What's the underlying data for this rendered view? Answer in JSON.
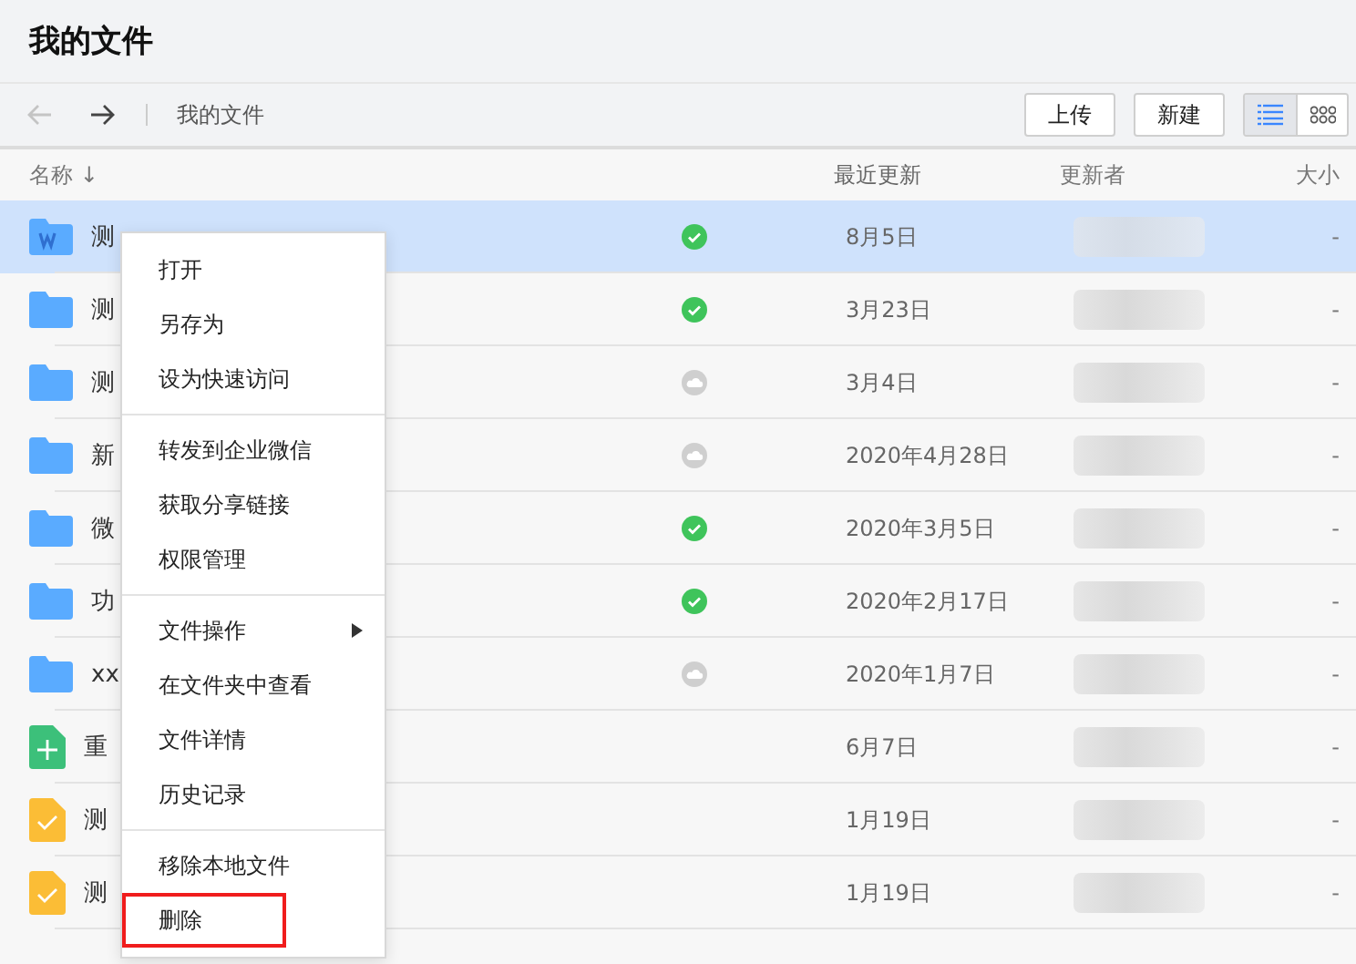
{
  "window": {
    "title": "我的文件"
  },
  "toolbar": {
    "back_disabled": true,
    "forward_disabled": false,
    "breadcrumb": "我的文件",
    "buttons": [
      "上传",
      "新建"
    ],
    "views": [
      {
        "kind": "list",
        "selected": true
      },
      {
        "kind": "grid",
        "selected": false
      }
    ]
  },
  "columns": [
    {
      "label": "名称",
      "sort": "↓"
    },
    {
      "label": "最近更新"
    },
    {
      "label": "更新者"
    },
    {
      "label": "大小"
    }
  ],
  "rows": [
    {
      "kind": "word-folder",
      "name": "测",
      "synced": true,
      "updated": "8月5日",
      "size": "-",
      "selected": true
    },
    {
      "kind": "folder",
      "name": "测",
      "synced": true,
      "updated": "3月23日",
      "size": "-",
      "selected": false
    },
    {
      "kind": "folder",
      "name": "测",
      "synced": false,
      "updated": "3月4日",
      "size": "-",
      "selected": false
    },
    {
      "kind": "folder",
      "name": "新",
      "synced": false,
      "updated": "2020年4月28日",
      "size": "-",
      "selected": false
    },
    {
      "kind": "folder",
      "name": "微",
      "synced": true,
      "updated": "2020年3月5日",
      "size": "-",
      "selected": false
    },
    {
      "kind": "folder",
      "name": "功",
      "synced": true,
      "updated": "2020年2月17日",
      "size": "-",
      "selected": false
    },
    {
      "kind": "folder",
      "name": "xx",
      "synced": false,
      "updated": "2020年1月7日",
      "size": "-",
      "selected": false
    },
    {
      "kind": "sheet",
      "name": "重",
      "updated": "6月7日",
      "size": "-",
      "selected": false
    },
    {
      "kind": "task",
      "name": "测",
      "updated": "1月19日",
      "size": "-",
      "selected": false
    },
    {
      "kind": "task",
      "name": "测",
      "updated": "1月19日",
      "size": "-",
      "selected": false
    }
  ],
  "context_menu": {
    "groups": [
      [
        {
          "label": "打开",
          "submenu": false,
          "highlighted": false
        },
        {
          "label": "另存为",
          "submenu": false,
          "highlighted": false
        },
        {
          "label": "设为快速访问",
          "submenu": false,
          "highlighted": false
        }
      ],
      [
        {
          "label": "转发到企业微信",
          "submenu": false,
          "highlighted": false
        },
        {
          "label": "获取分享链接",
          "submenu": false,
          "highlighted": false
        },
        {
          "label": "权限管理",
          "submenu": false,
          "highlighted": false
        }
      ],
      [
        {
          "label": "文件操作",
          "submenu": true,
          "highlighted": false
        },
        {
          "label": "在文件夹中查看",
          "submenu": false,
          "highlighted": false
        },
        {
          "label": "文件详情",
          "submenu": false,
          "highlighted": false
        },
        {
          "label": "历史记录",
          "submenu": false,
          "highlighted": false
        }
      ],
      [
        {
          "label": "移除本地文件",
          "submenu": false,
          "highlighted": false
        },
        {
          "label": "删除",
          "submenu": false,
          "highlighted": true
        }
      ]
    ]
  }
}
